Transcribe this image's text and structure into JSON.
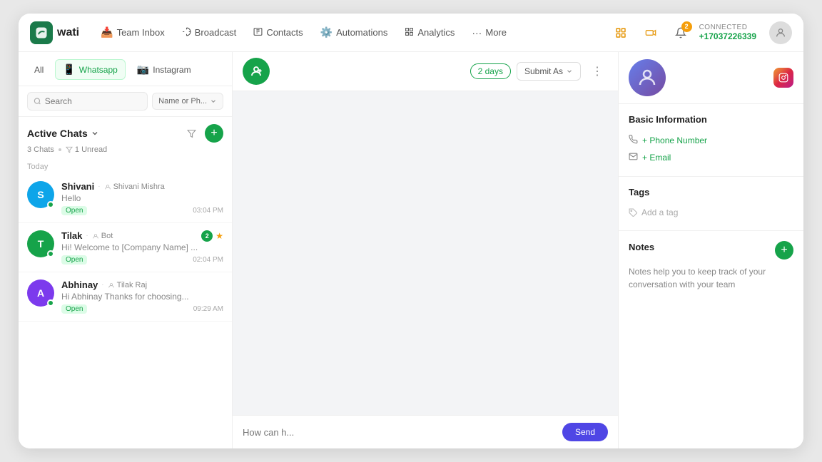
{
  "app": {
    "logo_text": "wati",
    "logo_icon": "💬"
  },
  "nav": {
    "items": [
      {
        "label": "Team Inbox",
        "icon": "📥"
      },
      {
        "label": "Broadcast",
        "icon": "📡"
      },
      {
        "label": "Contacts",
        "icon": "📋"
      },
      {
        "label": "Automations",
        "icon": "⚙️"
      },
      {
        "label": "Analytics",
        "icon": "📊"
      },
      {
        "label": "More",
        "icon": "···"
      }
    ],
    "connected_label": "CONNECTED",
    "connected_number": "+17037226339"
  },
  "sidebar": {
    "tabs": {
      "all": "All",
      "whatsapp": "Whatsapp",
      "instagram": "Instagram"
    },
    "search_placeholder": "Search",
    "filter_label": "Name or Ph...",
    "active_chats_title": "Active Chats",
    "chats_count": "3 Chats",
    "unread_count": "1 Unread",
    "today_label": "Today",
    "chats": [
      {
        "name": "Shivani",
        "agent": "Shivani Mishra",
        "preview": "Hello",
        "status": "Open",
        "time": "03:04 PM",
        "avatar_color": "#0ea5e9",
        "initials": "S",
        "unread": 0,
        "starred": false
      },
      {
        "name": "Tilak",
        "agent": "Bot",
        "preview": "Hi! Welcome to [Company Name] ...",
        "status": "Open",
        "time": "02:04 PM",
        "avatar_color": "#16a34a",
        "initials": "T",
        "unread": 2,
        "starred": true
      },
      {
        "name": "Abhinay",
        "agent": "Tilak Raj",
        "preview": "Hi Abhinay Thanks for choosing...",
        "status": "Open",
        "time": "09:29 AM",
        "avatar_color": "#7c3aed",
        "initials": "A",
        "unread": 0,
        "starred": false
      }
    ]
  },
  "chat_toolbar": {
    "days_label": "2 days",
    "submit_as_label": "Submit As",
    "more_icon": "⋮"
  },
  "right_panel": {
    "basic_info_title": "Basic Information",
    "phone_label": "+ Phone Number",
    "email_label": "+ Email",
    "tags_title": "Tags",
    "add_tag_label": "Add a tag",
    "notes_title": "Notes",
    "notes_text": "Notes help you to keep track of your conversation with your team"
  },
  "chat_input": {
    "placeholder": "How can h...",
    "send_label": "Send"
  }
}
